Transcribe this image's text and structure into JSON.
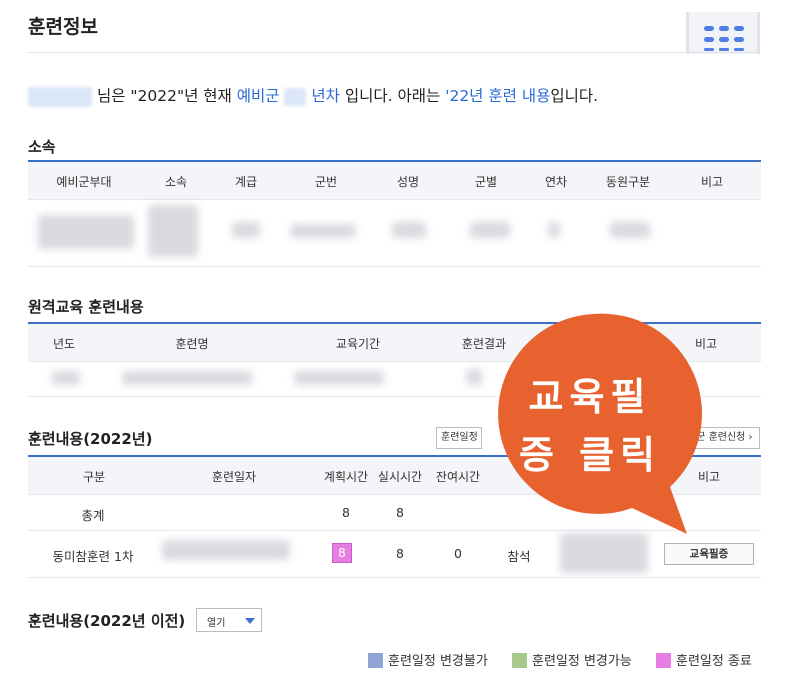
{
  "page": {
    "title": "훈련정보"
  },
  "intro": {
    "suffix_name": "님은 \"2022\"년 현재 ",
    "reserve": "예비군",
    "year_suffix": "년차",
    "middle": " 입니다. 아래는 ",
    "training_link": "'22년 훈련 내용",
    "end": "입니다."
  },
  "affiliation": {
    "title": "소속",
    "columns": [
      "예비군부대",
      "소속",
      "계급",
      "군번",
      "성명",
      "군별",
      "연차",
      "동원구분",
      "비고"
    ]
  },
  "remote": {
    "title": "원격교육 훈련내용",
    "columns": [
      "년도",
      "훈련명",
      "교육기간",
      "훈련결과",
      "비고"
    ]
  },
  "training": {
    "title": "훈련내용(2022년)",
    "schedule_button": "훈련일정",
    "apply_button": "비군 훈련신청 ›",
    "columns": [
      "구분",
      "훈련일자",
      "계획시간",
      "실시시간",
      "잔여시간",
      "비고"
    ],
    "total_row": {
      "label": "총계",
      "planned": "8",
      "actual": "8"
    },
    "row1": {
      "label": "동미참훈련 1차",
      "planned": "8",
      "actual": "8",
      "remaining": "0",
      "status": "참석",
      "cert_button": "교육필증"
    }
  },
  "callout": {
    "line1": "교육필",
    "line2": "증 클릭",
    "color": "#e8622f"
  },
  "history": {
    "title": "훈련내용(2022년 이전)",
    "dropdown_value": "열기"
  },
  "legend": [
    {
      "label": "훈련일정 변경불가",
      "color": "#8fa3d6"
    },
    {
      "label": "훈련일정 변경가능",
      "color": "#a7c98c"
    },
    {
      "label": "훈련일정 종료",
      "color": "#e77ee3"
    }
  ],
  "icons": {
    "menu": "grid-menu-icon",
    "dropdown": "caret-down-icon"
  }
}
